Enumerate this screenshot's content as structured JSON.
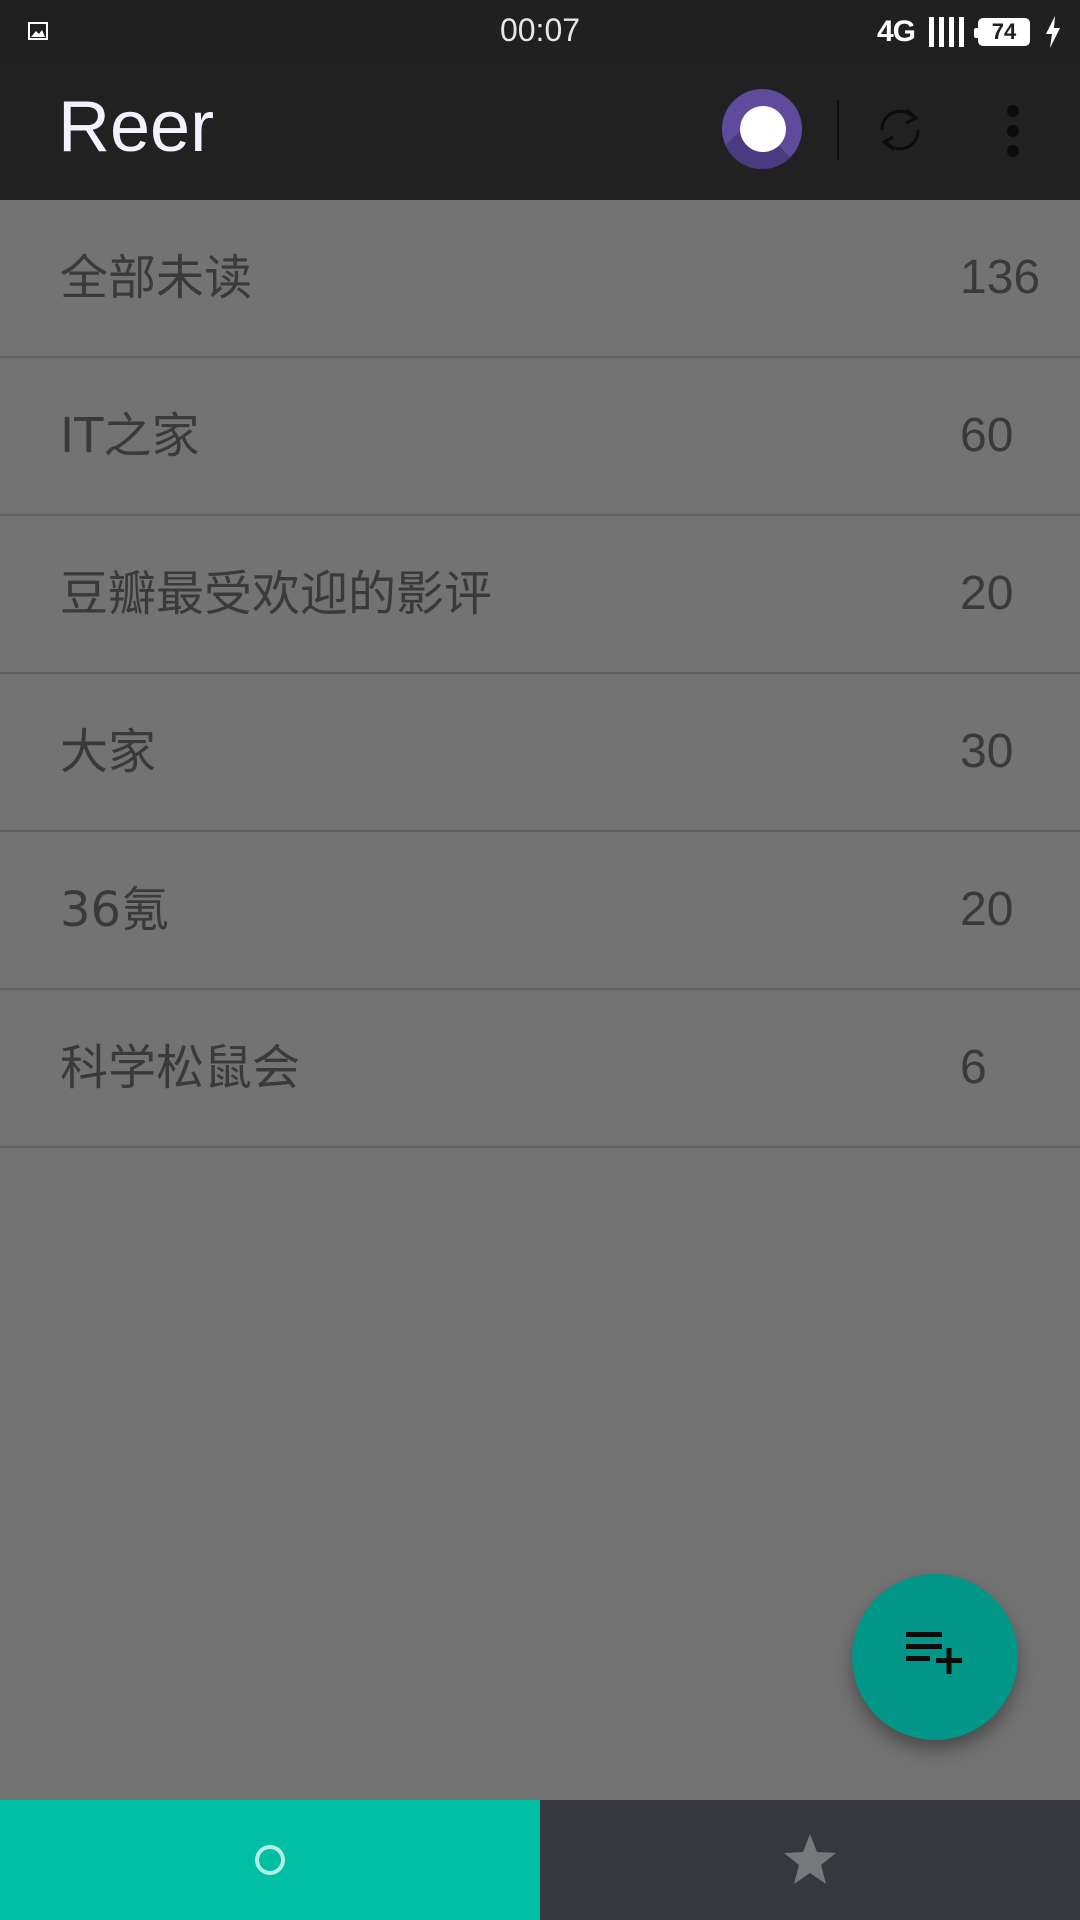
{
  "status_bar": {
    "time": "00:07",
    "network": "4G",
    "battery": "74",
    "left_icon": "image-icon",
    "charging_icon": "bolt-icon"
  },
  "app_bar": {
    "title": "Reer",
    "icons": [
      "theme-toggle",
      "refresh-icon",
      "more-vert-icon"
    ]
  },
  "feeds": [
    {
      "name": "全部未读",
      "count": "136"
    },
    {
      "name": "IT之家",
      "count": "60"
    },
    {
      "name": "豆瓣最受欢迎的影评",
      "count": "20"
    },
    {
      "name": "大家",
      "count": "30"
    },
    {
      "name": "36氪",
      "count": "20"
    },
    {
      "name": "科学松鼠会",
      "count": "6"
    }
  ],
  "fab": {
    "icon": "playlist-add-icon"
  },
  "bottom_nav": {
    "items": [
      {
        "icon": "circle-icon",
        "active": true
      },
      {
        "icon": "star-icon",
        "active": false
      }
    ]
  },
  "colors": {
    "status_bar": "#202020",
    "app_bar": "#212121",
    "list_background": "#737373",
    "fab": "#009688",
    "nav_active": "#00bfa5",
    "nav_inactive": "#37383d",
    "theme_toggle": "#5e4b9c"
  }
}
